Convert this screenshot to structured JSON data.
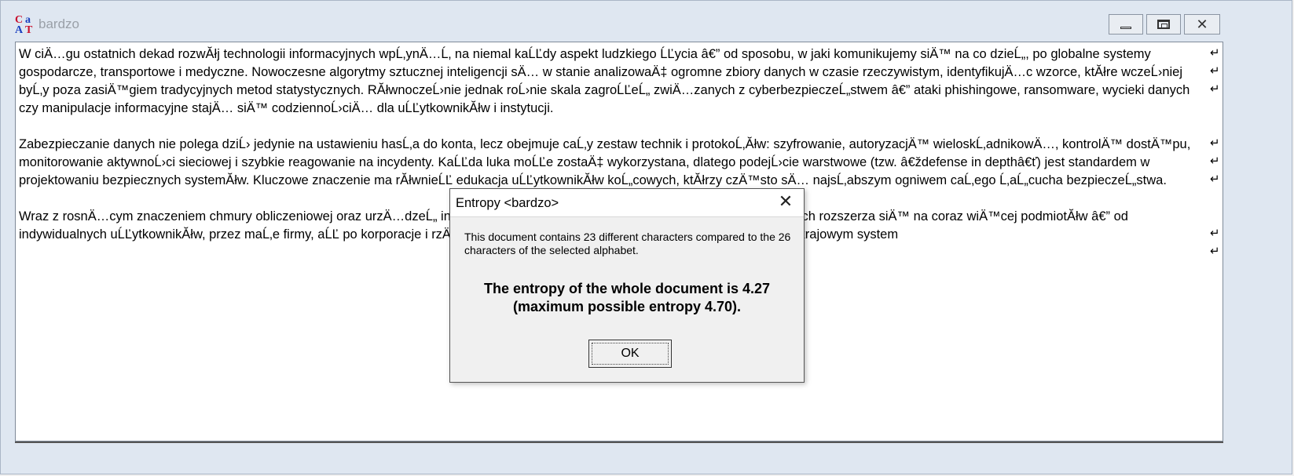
{
  "window": {
    "title": "bardzo"
  },
  "editor": {
    "paragraphs": [
      "W ciÄ…gu ostatnich dekad rozwĂłj technologii informacyjnych wpĹ‚ynÄ…Ĺ‚ na niemal kaĹĽdy aspekt ludzkiego ĹĽycia â€” od sposobu, w jaki komunikujemy siÄ™ na co dzieĹ„, po globalne systemy gospodarcze, transportowe i medyczne. Nowoczesne algorytmy sztucznej inteligencji sÄ… w stanie analizowaÄ‡ ogromne zbiory danych w czasie rzeczywistym, identyfikujÄ…c wzorce, ktĂłre wczeĹ›niej byĹ‚y poza zasiÄ™giem tradycyjnych metod statystycznych. RĂłwnoczeĹ›nie jednak roĹ›nie skala zagroĹĽeĹ„ zwiÄ…zanych z cyberbezpieczeĹ„stwem â€” ataki phishingowe, ransomware, wycieki danych czy manipulacje informacyjne stajÄ… siÄ™ codziennoĹ›ciÄ… dla uĹĽytkownikĂłw i instytucji.",
      "Zabezpieczanie danych nie polega dziĹ› jedynie na ustawieniu hasĹ‚a do konta, lecz obejmuje caĹ‚y zestaw technik i protokoĹ‚Ăłw: szyfrowanie, autoryzacjÄ™ wieloskĹ‚adnikowÄ…, kontrolÄ™ dostÄ™pu, monitorowanie aktywnoĹ›ci sieciowej i szybkie reagowanie na incydenty. KaĹĽda luka moĹĽe zostaÄ‡ wykorzystana, dlatego podejĹ›cie warstwowe (tzw. â€ždefense in depthâ€ť) jest standardem w projektowaniu bezpiecznych systemĂłw. Kluczowe znaczenie ma rĂłwnieĹĽ edukacja uĹĽytkownikĂłw koĹ„cowych, ktĂłrzy czÄ™sto sÄ… najsĹ‚abszym ogniwem caĹ‚ego Ĺ‚aĹ„cucha bezpieczeĹ„stwa.",
      "Wraz z rosnÄ…cym znaczeniem chmury obliczeniowej oraz urzÄ…dzeĹ„ internetu rzeczy grono posiadaczy cennych i wraĹĽliwych danych rozszerza siÄ™ na coraz wiÄ™cej podmiotĂłw â€” od indywidualnych uĹĽytkownikĂłw, przez maĹ‚e firmy, aĹĽ po korporacje i rzÄ…dy. Nowe regulacje prawne, takie jak RODO czy ustawa o krajowym system"
    ],
    "pilcrow": "↵"
  },
  "dialog": {
    "title": "Entropy <bardzo>",
    "message": "This document contains 23 different characters compared to the 26 characters of the selected alphabet.",
    "entropy_line1": "The entropy of the whole document is 4.27",
    "entropy_line2": "(maximum possible entropy 4.70).",
    "ok_label": "OK",
    "close_glyph": "✕"
  },
  "icons": {
    "app": "cryptool-icon",
    "minimize": "minimize-icon",
    "maximize": "maximize-icon",
    "close": "close-icon"
  }
}
